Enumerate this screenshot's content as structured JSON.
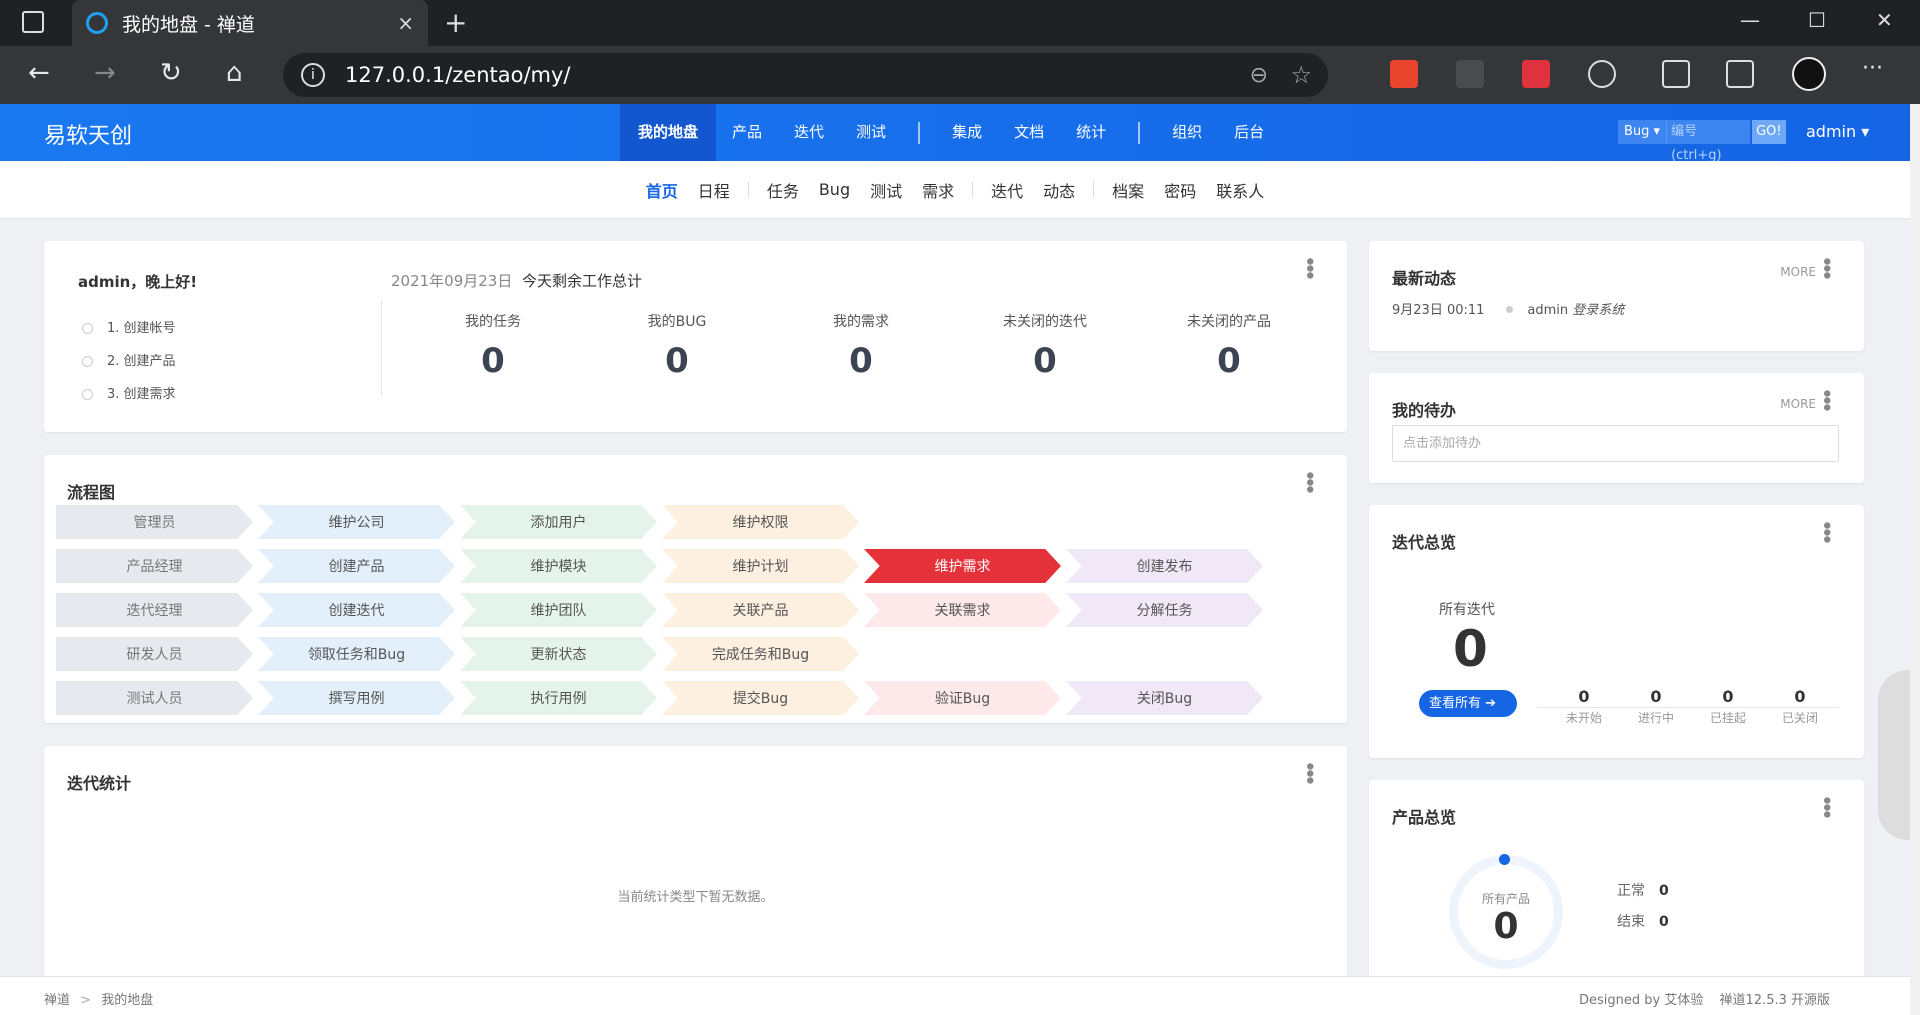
{
  "browser": {
    "tab_title": "我的地盘 - 禅道",
    "url": "127.0.0.1/zentao/my/",
    "tab_close": "×",
    "new_tab": "+",
    "back": "←",
    "forward": "→",
    "reload": "↻",
    "home": "⌂",
    "zoom": "⊖",
    "star": "☆",
    "menu": "···",
    "minimize": "—",
    "maximize": "☐",
    "close": "✕"
  },
  "app": {
    "brand": "易软天创",
    "nav": [
      "我的地盘",
      "产品",
      "迭代",
      "测试",
      "集成",
      "文档",
      "统计",
      "组织",
      "后台"
    ],
    "search_type": "Bug ▾",
    "search_placeholder": "编号(ctrl+g)",
    "go": "GO!",
    "user": "admin ▾"
  },
  "subnav": [
    "首页",
    "日程",
    "任务",
    "Bug",
    "测试",
    "需求",
    "迭代",
    "动态",
    "档案",
    "密码",
    "联系人"
  ],
  "welcome": {
    "greeting": "admin，晚上好!",
    "steps": [
      "1. 创建帐号",
      "2. 创建产品",
      "3. 创建需求"
    ],
    "date": "2021年09月23日",
    "summary": "今天剩余工作总计",
    "stats": [
      {
        "label": "我的任务",
        "value": "0"
      },
      {
        "label": "我的BUG",
        "value": "0"
      },
      {
        "label": "我的需求",
        "value": "0"
      },
      {
        "label": "未关闭的迭代",
        "value": "0"
      },
      {
        "label": "未关闭的产品",
        "value": "0"
      }
    ]
  },
  "flow": {
    "title": "流程图",
    "rows": [
      [
        "管理员",
        "维护公司",
        "添加用户",
        "维护权限"
      ],
      [
        "产品经理",
        "创建产品",
        "维护模块",
        "维护计划",
        "维护需求",
        "创建发布"
      ],
      [
        "迭代经理",
        "创建迭代",
        "维护团队",
        "关联产品",
        "关联需求",
        "分解任务"
      ],
      [
        "研发人员",
        "领取任务和Bug",
        "更新状态",
        "完成任务和Bug"
      ],
      [
        "测试人员",
        "撰写用例",
        "执行用例",
        "提交Bug",
        "验证Bug",
        "关闭Bug"
      ]
    ]
  },
  "iterstats": {
    "title": "迭代统计",
    "empty": "当前统计类型下暂无数据。"
  },
  "dynamic": {
    "title": "最新动态",
    "more": "MORE",
    "time": "9月23日 00:11",
    "user": "admin",
    "action": "登录系统"
  },
  "todo": {
    "title": "我的待办",
    "more": "MORE",
    "placeholder": "点击添加待办"
  },
  "iteration": {
    "title": "迭代总览",
    "all_label": "所有迭代",
    "all_value": "0",
    "button": "查看所有 ➔",
    "stats": [
      {
        "value": "0",
        "label": "未开始"
      },
      {
        "value": "0",
        "label": "进行中"
      },
      {
        "value": "0",
        "label": "已挂起"
      },
      {
        "value": "0",
        "label": "已关闭"
      }
    ]
  },
  "product": {
    "title": "产品总览",
    "all_label": "所有产品",
    "all_value": "0",
    "normal_label": "正常",
    "normal_value": "0",
    "closed_label": "结束",
    "closed_value": "0"
  },
  "footer": {
    "crumb_root": "禅道",
    "crumb_sep": ">",
    "crumb_page": "我的地盘",
    "designed": "Designed by 艾体验",
    "version": "禅道12.5.3 开源版"
  },
  "colors": {
    "brand_blue": "#1565e5",
    "highlight_red": "#e5323a"
  }
}
